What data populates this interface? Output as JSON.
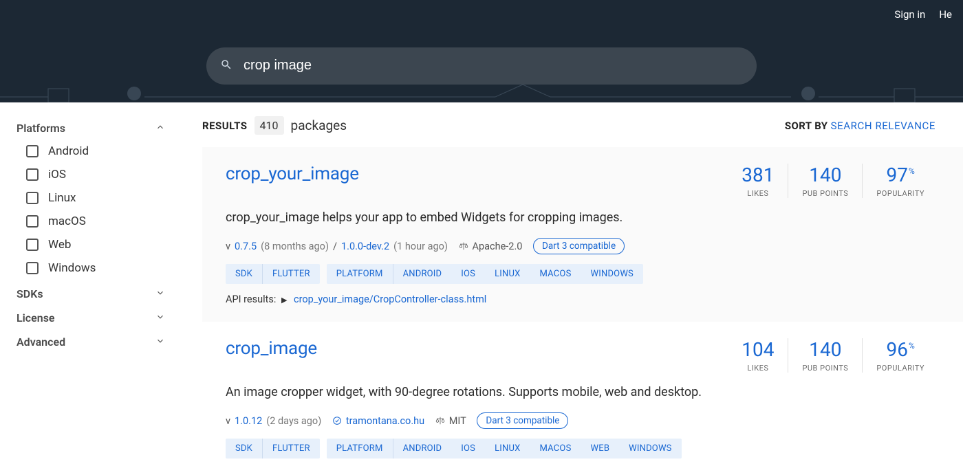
{
  "topbar": {
    "sign_in": "Sign in",
    "help": "He"
  },
  "search": {
    "value": "crop image"
  },
  "results": {
    "label": "RESULTS",
    "count": "410",
    "suffix": "packages"
  },
  "sort": {
    "label": "SORT BY",
    "value": "SEARCH RELEVANCE"
  },
  "filters": {
    "platforms": {
      "title": "Platforms",
      "items": [
        "Android",
        "iOS",
        "Linux",
        "macOS",
        "Web",
        "Windows"
      ]
    },
    "sdks": {
      "title": "SDKs"
    },
    "license": {
      "title": "License"
    },
    "advanced": {
      "title": "Advanced"
    }
  },
  "packages": [
    {
      "name": "crop_your_image",
      "desc": "crop_your_image helps your app to embed Widgets for cropping images.",
      "v_prefix": "v ",
      "version": "0.7.5",
      "version_age": "(8 months ago)",
      "sep": " / ",
      "prerelease": "1.0.0-dev.2",
      "prerelease_age": "(1 hour ago)",
      "license": "Apache-2.0",
      "dart3": "Dart 3 compatible",
      "tag_sdk_label": "SDK",
      "tag_sdk_items": [
        "FLUTTER"
      ],
      "tag_platform_label": "PLATFORM",
      "tag_platform_items": [
        "ANDROID",
        "IOS",
        "LINUX",
        "MACOS",
        "WINDOWS"
      ],
      "api_label": "API results:",
      "api_link": "crop_your_image/CropController-class.html",
      "scores": {
        "likes": "381",
        "likes_lbl": "LIKES",
        "points": "140",
        "points_lbl": "PUB POINTS",
        "pop": "97",
        "pop_pct": "%",
        "pop_lbl": "POPULARITY"
      }
    },
    {
      "name": "crop_image",
      "desc": "An image cropper widget, with 90-degree rotations. Supports mobile, web and desktop.",
      "v_prefix": "v ",
      "version": "1.0.12",
      "version_age": "(2 days ago)",
      "publisher": "tramontana.co.hu",
      "license": "MIT",
      "dart3": "Dart 3 compatible",
      "tag_sdk_label": "SDK",
      "tag_sdk_items": [
        "FLUTTER"
      ],
      "tag_platform_label": "PLATFORM",
      "tag_platform_items": [
        "ANDROID",
        "IOS",
        "LINUX",
        "MACOS",
        "WEB",
        "WINDOWS"
      ],
      "scores": {
        "likes": "104",
        "likes_lbl": "LIKES",
        "points": "140",
        "points_lbl": "PUB POINTS",
        "pop": "96",
        "pop_pct": "%",
        "pop_lbl": "POPULARITY"
      }
    }
  ]
}
